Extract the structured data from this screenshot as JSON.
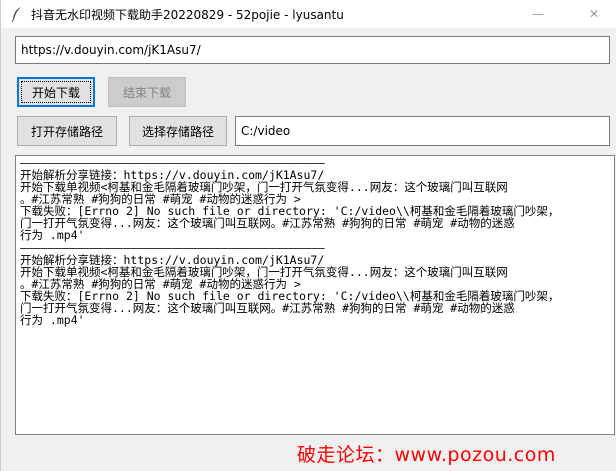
{
  "window": {
    "title": "抖音无水印视频下载助手20220829 - 52pojie - lyusantu",
    "minimize_glyph": "—",
    "maximize_glyph": "☐",
    "close_glyph": "✕"
  },
  "inputs": {
    "url_value": "https://v.douyin.com/jK1Asu7/",
    "path_value": "C:/video"
  },
  "buttons": {
    "start_label": "开始下载",
    "stop_label": "结束下载",
    "open_path_label": "打开存储路径",
    "choose_path_label": "选择存储路径"
  },
  "log": {
    "lines": [
      "————————————————————————————————————————————",
      "开始解析分享链接：https://v.douyin.com/jK1Asu7/",
      "开始下载单视频<柯基和金毛隔着玻璃门吵架，门一打开气氛变得...网友：这个玻璃门叫互联网",
      "。#江苏常熟 #狗狗的日常 #萌宠 #动物的迷惑行为 >",
      "下载失败：[Errno 2] No such file or directory: 'C:/video\\\\柯基和金毛隔着玻璃门吵架，",
      "门一打开气氛变得...网友：这个玻璃门叫互联网。#江苏常熟 #狗狗的日常 #萌宠 #动物的迷惑",
      "行为 .mp4'",
      "————————————————————————————————————————————",
      "开始解析分享链接：https://v.douyin.com/jK1Asu7/",
      "开始下载单视频<柯基和金毛隔着玻璃门吵架，门一打开气氛变得...网友：这个玻璃门叫互联网",
      "。#江苏常熟 #狗狗的日常 #萌宠 #动物的迷惑行为 >",
      "下载失败：[Errno 2] No such file or directory: 'C:/video\\\\柯基和金毛隔着玻璃门吵架，",
      "门一打开气氛变得...网友：这个玻璃门叫互联网。#江苏常熟 #狗狗的日常 #萌宠 #动物的迷惑",
      "行为 .mp4'"
    ]
  },
  "watermark": "破走论坛：www.pozou.com",
  "icons": {
    "app": "feather-icon"
  }
}
